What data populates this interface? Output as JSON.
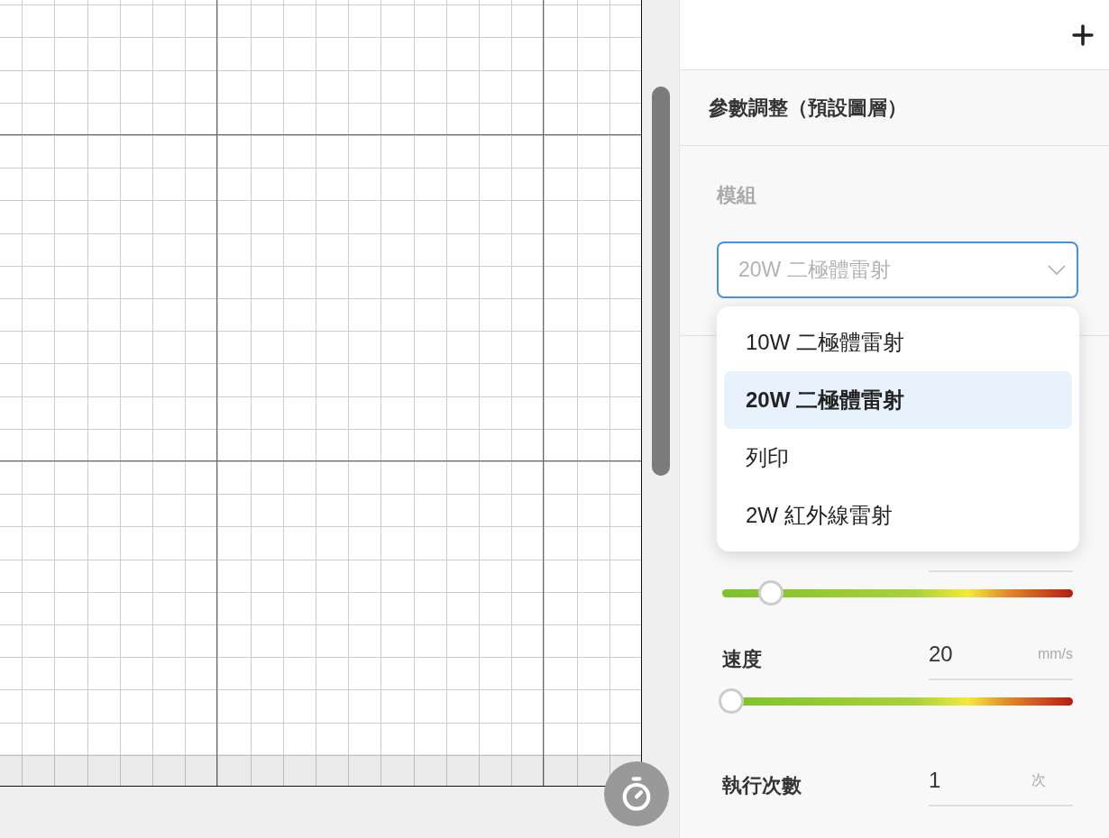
{
  "panel": {
    "title": "參數調整（預設圖層）",
    "module": {
      "label": "模組",
      "value": "20W 二極體雷射",
      "expanded": true,
      "options": [
        {
          "label": "10W 二極體雷射",
          "selected": false
        },
        {
          "label": "20W 二極體雷射",
          "selected": true
        },
        {
          "label": "列印",
          "selected": false
        },
        {
          "label": "2W 紅外線雷射",
          "selected": false
        }
      ]
    },
    "power": {
      "level": 0.14
    },
    "speed": {
      "label": "速度",
      "value": "20",
      "unit": "mm/s",
      "level": 0.02
    },
    "passes": {
      "label": "執行次數",
      "value": "1",
      "unit": "次"
    }
  }
}
